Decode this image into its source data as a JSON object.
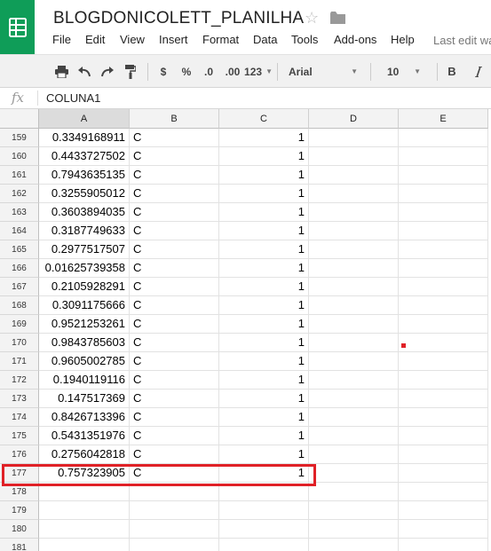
{
  "doc": {
    "title": "BLOGDONICOLETT_PLANILHA"
  },
  "menu": [
    {
      "label": "File"
    },
    {
      "label": "Edit"
    },
    {
      "label": "View"
    },
    {
      "label": "Insert"
    },
    {
      "label": "Format"
    },
    {
      "label": "Data"
    },
    {
      "label": "Tools"
    },
    {
      "label": "Add-ons"
    },
    {
      "label": "Help"
    }
  ],
  "last_edit": "Last edit wa",
  "toolbar": {
    "icons": [
      "print-icon",
      "undo-icon",
      "redo-icon",
      "paint-format-icon"
    ],
    "currency": "$",
    "percent": "%",
    "dec_decrease": ".0",
    "dec_increase": ".00",
    "more_formats": "123",
    "font": "Arial",
    "size": "10",
    "bold": "B"
  },
  "formula_bar": {
    "fx": "fx",
    "value": "COLUNA1"
  },
  "columns": [
    "A",
    "B",
    "C",
    "D",
    "E"
  ],
  "rows": [
    {
      "n": "159",
      "a": "0.3349168911",
      "b": "C",
      "c": "1"
    },
    {
      "n": "160",
      "a": "0.4433727502",
      "b": "C",
      "c": "1"
    },
    {
      "n": "161",
      "a": "0.7943635135",
      "b": "C",
      "c": "1"
    },
    {
      "n": "162",
      "a": "0.3255905012",
      "b": "C",
      "c": "1"
    },
    {
      "n": "163",
      "a": "0.3603894035",
      "b": "C",
      "c": "1"
    },
    {
      "n": "164",
      "a": "0.3187749633",
      "b": "C",
      "c": "1"
    },
    {
      "n": "165",
      "a": "0.2977517507",
      "b": "C",
      "c": "1"
    },
    {
      "n": "166",
      "a": "0.01625739358",
      "b": "C",
      "c": "1"
    },
    {
      "n": "167",
      "a": "0.2105928291",
      "b": "C",
      "c": "1"
    },
    {
      "n": "168",
      "a": "0.3091175666",
      "b": "C",
      "c": "1"
    },
    {
      "n": "169",
      "a": "0.9521253261",
      "b": "C",
      "c": "1"
    },
    {
      "n": "170",
      "a": "0.9843785603",
      "b": "C",
      "c": "1"
    },
    {
      "n": "171",
      "a": "0.9605002785",
      "b": "C",
      "c": "1"
    },
    {
      "n": "172",
      "a": "0.1940119116",
      "b": "C",
      "c": "1"
    },
    {
      "n": "173",
      "a": "0.147517369",
      "b": "C",
      "c": "1"
    },
    {
      "n": "174",
      "a": "0.8426713396",
      "b": "C",
      "c": "1"
    },
    {
      "n": "175",
      "a": "0.5431351976",
      "b": "C",
      "c": "1"
    },
    {
      "n": "176",
      "a": "0.2756042818",
      "b": "C",
      "c": "1"
    },
    {
      "n": "177",
      "a": "0.757323905",
      "b": "C",
      "c": "1"
    },
    {
      "n": "178",
      "a": "",
      "b": "",
      "c": ""
    },
    {
      "n": "179",
      "a": "",
      "b": "",
      "c": ""
    },
    {
      "n": "180",
      "a": "",
      "b": "",
      "c": ""
    },
    {
      "n": "181",
      "a": "",
      "b": "",
      "c": ""
    }
  ],
  "colors": {
    "highlight": "#e02127",
    "brand": "#0f9d58"
  }
}
